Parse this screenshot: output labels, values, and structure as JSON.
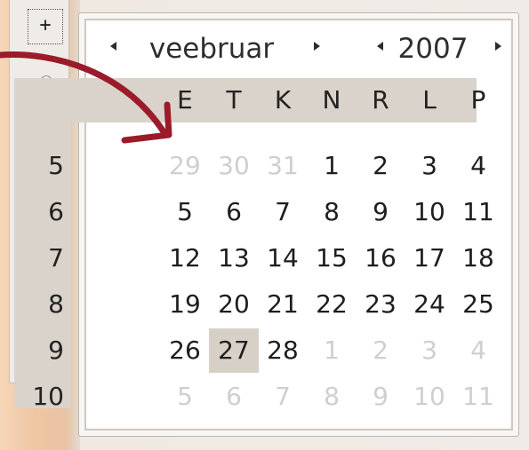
{
  "zoom": {
    "plus_label": "+",
    "minus_label": "-",
    "level_fraction": 0.35
  },
  "calendar": {
    "month": "veebruar",
    "year": "2007",
    "prev_month_icon": "left-arrow-icon",
    "next_month_icon": "right-arrow-icon",
    "weekdays": [
      "E",
      "T",
      "K",
      "N",
      "R",
      "L",
      "P"
    ],
    "weeks": [
      {
        "num": "5",
        "days": [
          "29",
          "30",
          "31",
          "1",
          "2",
          "3",
          "4"
        ],
        "other": [
          true,
          true,
          true,
          false,
          false,
          false,
          false
        ]
      },
      {
        "num": "6",
        "days": [
          "5",
          "6",
          "7",
          "8",
          "9",
          "10",
          "11"
        ],
        "other": [
          false,
          false,
          false,
          false,
          false,
          false,
          false
        ]
      },
      {
        "num": "7",
        "days": [
          "12",
          "13",
          "14",
          "15",
          "16",
          "17",
          "18"
        ],
        "other": [
          false,
          false,
          false,
          false,
          false,
          false,
          false
        ]
      },
      {
        "num": "8",
        "days": [
          "19",
          "20",
          "21",
          "22",
          "23",
          "24",
          "25"
        ],
        "other": [
          false,
          false,
          false,
          false,
          false,
          false,
          false
        ]
      },
      {
        "num": "9",
        "days": [
          "26",
          "27",
          "28",
          "1",
          "2",
          "3",
          "4"
        ],
        "other": [
          false,
          false,
          false,
          true,
          true,
          true,
          true
        ]
      },
      {
        "num": "10",
        "days": [
          "5",
          "6",
          "7",
          "8",
          "9",
          "10",
          "11"
        ],
        "other": [
          true,
          true,
          true,
          true,
          true,
          true,
          true
        ]
      }
    ],
    "selected_day": "27"
  },
  "colors": {
    "accent_orange": "#f08a3c",
    "arrow_red": "#9b1b2a",
    "band_gray": "#d9d3cb"
  }
}
